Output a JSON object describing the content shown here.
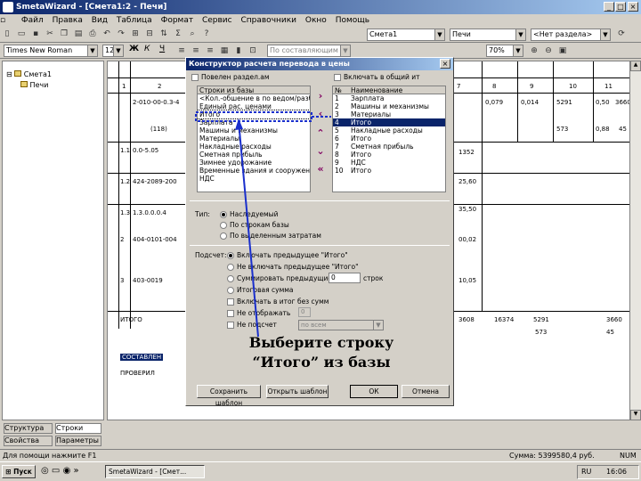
{
  "window": {
    "title": "SmetaWizard - [Смета1:2 - Печи]"
  },
  "menu": [
    "Файл",
    "Правка",
    "Вид",
    "Таблица",
    "Формат",
    "Сервис",
    "Справочники",
    "Окно",
    "Помощь"
  ],
  "toolbar1": {
    "combo1": "Смета1",
    "combo2": "Печи",
    "combo3": "<Нет раздела>"
  },
  "toolbar2": {
    "font": "Times New Roman",
    "size": "12",
    "bold": "Ж",
    "italic": "К",
    "underline": "Ч",
    "style": "По составляющим",
    "zoom": "70%"
  },
  "tree": {
    "root": "Смета1",
    "child": "Печи"
  },
  "tabs": {
    "structure": "Структура",
    "rows": "Строки",
    "properties": "Свойства",
    "params": "Параметры"
  },
  "sheet": {
    "header_nums": [
      "1",
      "2",
      "7",
      "8",
      "9",
      "10",
      "11"
    ],
    "rows": [
      {
        "c1": "",
        "c2": "2-010-00-0.3-4",
        "c3": "0,079",
        "c4": "0,014",
        "c5": "5291",
        "c6": "0,50",
        "c7": "3660"
      },
      {
        "c1": "",
        "c2": "(118)",
        "c3": "",
        "c4": "",
        "c5": "573",
        "c6": "0,88",
        "c7": "45"
      },
      {
        "c1": "1.1",
        "c2": "0.0-5.05",
        "c3": "",
        "c4": "",
        "c5": "",
        "c6": "",
        "c7": ""
      },
      {
        "c1": "1.2",
        "c2": "424-2089-200",
        "c3": "",
        "c4": "",
        "c5": "",
        "c6": "",
        "c7": ""
      },
      {
        "c1": "1.3",
        "c2": "1.3.0.0.0.4",
        "c3": "",
        "c4": "",
        "c5": "",
        "c6": "",
        "c7": ""
      },
      {
        "c1": "2",
        "c2": "404-0101-004",
        "c3": "",
        "c4": "",
        "c5": "",
        "c6": "",
        "c7": ""
      },
      {
        "c1": "3",
        "c2": "403-0019",
        "c3": "",
        "c4": "",
        "c5": "",
        "c6": "",
        "c7": ""
      }
    ],
    "side_vals": [
      "1352",
      "25,60",
      "35,50",
      "00,02",
      "10,05"
    ],
    "total_label": "ИТОГО",
    "total_vals": [
      "3608",
      "16374",
      "5291",
      "3660"
    ],
    "total_vals2": [
      "573",
      "45"
    ],
    "compiled": "СОСТАВЛЕН",
    "checked": "ПРОВЕРИЛ"
  },
  "status": {
    "left": "Для помощи нажмите F1",
    "right": "Сумма: 5399580,4 руб.",
    "num": "NUM"
  },
  "taskbar": {
    "start": "Пуск",
    "task": "SmetaWizard - [Смет...",
    "lang": "RU",
    "time": "16:06"
  },
  "dialog": {
    "title": "Конструктор расчета перевода в цены",
    "new_section": "Повелен раздел.ам",
    "include_total": "Включать в общий ит",
    "left_header": "Строки из базы",
    "left_items": [
      "<Кол.-обшение в по ведом/разбок>",
      "Единый рас. ценами",
      "Итого",
      "Зарплата",
      "Машины и механизмы",
      "Материалы",
      "Накладные расходы",
      "Сметная прибыль",
      "Зимнее удорожание",
      "Временные здания и сооружения",
      "НДС"
    ],
    "right_header_no": "№",
    "right_header_name": "Наименование",
    "right_items": [
      {
        "no": "1",
        "name": "Зарплата"
      },
      {
        "no": "2",
        "name": "Машины и механизмы"
      },
      {
        "no": "3",
        "name": "Материалы"
      },
      {
        "no": "4",
        "name": "Итого"
      },
      {
        "no": "5",
        "name": "Накладные расходы"
      },
      {
        "no": "6",
        "name": "Итого"
      },
      {
        "no": "7",
        "name": "Сметная прибыль"
      },
      {
        "no": "8",
        "name": "Итого"
      },
      {
        "no": "9",
        "name": "НДС"
      },
      {
        "no": "10",
        "name": "Итого"
      }
    ],
    "type_label": "Тип:",
    "type_options": [
      "Наследуемый",
      "По строкам базы",
      "По выделенным затратам"
    ],
    "count_label": "Подсчет:",
    "count_options": [
      "Включать предыдущее \"Итого\"",
      "Не включать предыдущее \"Итого\"",
      "Суммировать предыдущие",
      "Итоговая сумма"
    ],
    "count_value": "0",
    "count_suffix": "строк",
    "checkboxes": [
      "Включать в итог без сумм",
      "Не отображать",
      "Не подсчет"
    ],
    "check_value": "0",
    "combo_value": "по всем",
    "buttons": {
      "save": "Сохранить шаблон",
      "open": "Открыть шаблон",
      "ok": "ОК",
      "cancel": "Отмена"
    }
  },
  "callout": {
    "line1": "Выберите строку",
    "line2": "“Итого” из базы"
  },
  "colors": {
    "title": "#0a246a",
    "selection": "#0a246a",
    "annotation": "#1a2fcc"
  }
}
